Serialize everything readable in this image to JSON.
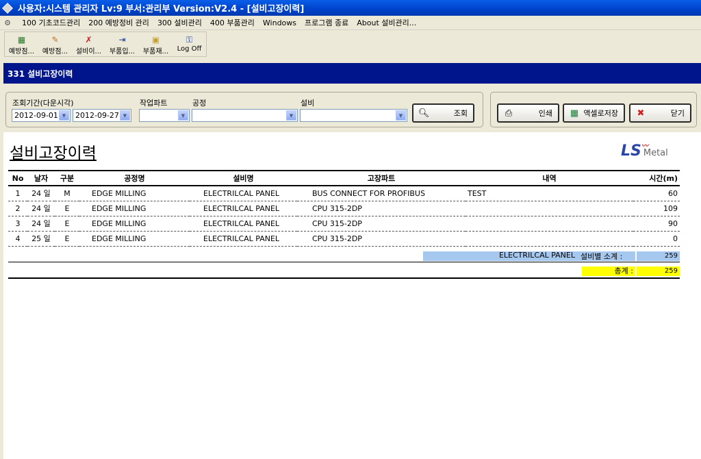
{
  "window": {
    "title": "사용자:시스템 관리자 Lv:9  부서:관리부  Version:V2.4 - [설비고장이력]"
  },
  "menu": [
    "100 기초코드관리",
    "200 예방정비 관리",
    "300 설비관리",
    "400 부품관리",
    "Windows",
    "프로그램 종료",
    "About 설비관리..."
  ],
  "toolbar": [
    {
      "label": "예방점...",
      "icon": "calendar-icon"
    },
    {
      "label": "예방점...",
      "icon": "pencil-icon"
    },
    {
      "label": "설비이...",
      "icon": "wrench-icon"
    },
    {
      "label": "부품입...",
      "icon": "import-icon"
    },
    {
      "label": "부품재...",
      "icon": "folder-icon"
    },
    {
      "label": "Log Off",
      "icon": "key-icon"
    }
  ],
  "form": {
    "header": "331 설비고장이력"
  },
  "search": {
    "period_label": "조회기간(다운시각)",
    "date_from": "2012-09-01",
    "date_to": "2012-09-27",
    "part_label": "작업파트",
    "part_value": "",
    "process_label": "공정",
    "process_value": "",
    "equipment_label": "설비",
    "equipment_value": "",
    "search_button": "조회"
  },
  "actions": {
    "print": "인쇄",
    "excel": "액셀로저장",
    "close": "닫기"
  },
  "report": {
    "title": "설비고장이력",
    "logo": "LS",
    "logo_sub": "Metal",
    "columns": [
      "No",
      "날자",
      "구분",
      "공정명",
      "설비명",
      "고장파트",
      "내역",
      "시간(m)"
    ],
    "rows": [
      [
        "1",
        "24 일",
        "M",
        "EDGE MILLING",
        "ELECTRILCAL PANEL",
        "BUS CONNECT FOR PROFIBUS",
        "TEST",
        "60"
      ],
      [
        "2",
        "24 일",
        "E",
        "EDGE MILLING",
        "ELECTRILCAL PANEL",
        "CPU 315-2DP",
        "",
        "109"
      ],
      [
        "3",
        "24 일",
        "E",
        "EDGE MILLING",
        "ELECTRILCAL PANEL",
        "CPU 315-2DP",
        "",
        "90"
      ],
      [
        "4",
        "25 일",
        "E",
        "EDGE MILLING",
        "ELECTRILCAL PANEL",
        "CPU 315-2DP",
        "",
        "0"
      ]
    ],
    "subtotal_equipment": "ELECTRILCAL PANEL",
    "subtotal_caption": "설비별 소계 :",
    "subtotal_value": "259",
    "total_caption": "총계 :",
    "total_value": "259"
  },
  "colors": {
    "title_bar": "#0044cc",
    "form_header": "#00148c",
    "subtotal": "#a6c8ee",
    "total": "#ffff00"
  }
}
